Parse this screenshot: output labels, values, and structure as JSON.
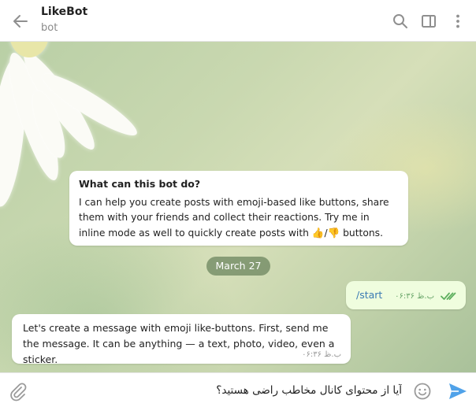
{
  "header": {
    "title": "LikeBot",
    "subtitle": "bot",
    "icons": [
      "back-arrow-icon",
      "search-icon",
      "sidebar-toggle-icon",
      "more-vert-icon"
    ]
  },
  "info_card": {
    "title": "What can this bot do?",
    "body_before": "I can help you create posts with emoji-based like buttons, share them with your friends and collect their reactions. Try me in inline mode as well to quickly create posts with ",
    "emoji_up": "👍",
    "separator": "/",
    "emoji_down": "👎",
    "body_after": " buttons."
  },
  "date_separator": "March 27",
  "messages": {
    "outgoing": {
      "text": "/start",
      "time": "ب.ظ ۰۶:۳۶"
    },
    "incoming": {
      "text": "Let's create a message with emoji like-buttons. First, send me the message. It can be anything — a text, photo, video, even a sticker.",
      "time": "ب.ظ ۰۶:۳۶"
    }
  },
  "composer": {
    "input_value": "آیا از محتوای کانال مخاطب راضی هستید؟",
    "icons": [
      "paperclip-icon",
      "emoji-icon",
      "send-icon"
    ]
  },
  "colors": {
    "accent": "#50a2e9",
    "outgoing_bubble": "#effdde",
    "date_pill": "#5c7852",
    "check": "#5fb05f"
  }
}
